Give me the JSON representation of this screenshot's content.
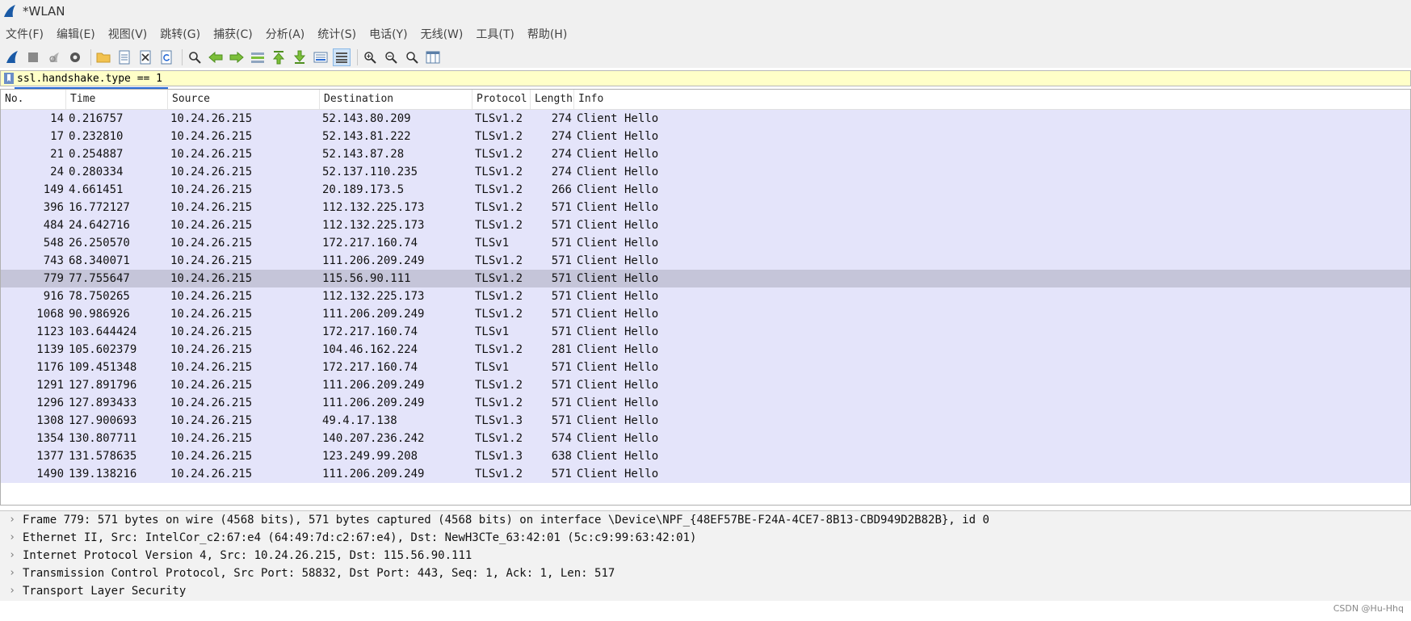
{
  "window": {
    "title": "*WLAN"
  },
  "menu": [
    "文件(F)",
    "编辑(E)",
    "视图(V)",
    "跳转(G)",
    "捕获(C)",
    "分析(A)",
    "统计(S)",
    "电话(Y)",
    "无线(W)",
    "工具(T)",
    "帮助(H)"
  ],
  "toolbar": {
    "icons": [
      "shark-fin-start-icon",
      "stop-capture-icon",
      "restart-capture-icon",
      "capture-options-icon",
      "open-folder-icon",
      "save-file-icon",
      "close-file-icon",
      "reload-icon",
      "find-packet-icon",
      "go-back-icon",
      "go-forward-icon",
      "go-to-packet-icon",
      "go-first-icon",
      "go-last-icon",
      "auto-scroll-icon",
      "colorize-icon",
      "zoom-in-icon",
      "zoom-out-icon",
      "zoom-reset-icon",
      "resize-columns-icon"
    ]
  },
  "filter": {
    "value": "ssl.handshake.type == 1"
  },
  "columns": [
    "No.",
    "Time",
    "Source",
    "Destination",
    "Protocol",
    "Length",
    "Info"
  ],
  "packets": [
    {
      "no": "14",
      "time": "0.216757",
      "src": "10.24.26.215",
      "dst": "52.143.80.209",
      "proto": "TLSv1.2",
      "len": "274",
      "info": "Client Hello"
    },
    {
      "no": "17",
      "time": "0.232810",
      "src": "10.24.26.215",
      "dst": "52.143.81.222",
      "proto": "TLSv1.2",
      "len": "274",
      "info": "Client Hello"
    },
    {
      "no": "21",
      "time": "0.254887",
      "src": "10.24.26.215",
      "dst": "52.143.87.28",
      "proto": "TLSv1.2",
      "len": "274",
      "info": "Client Hello"
    },
    {
      "no": "24",
      "time": "0.280334",
      "src": "10.24.26.215",
      "dst": "52.137.110.235",
      "proto": "TLSv1.2",
      "len": "274",
      "info": "Client Hello"
    },
    {
      "no": "149",
      "time": "4.661451",
      "src": "10.24.26.215",
      "dst": "20.189.173.5",
      "proto": "TLSv1.2",
      "len": "266",
      "info": "Client Hello"
    },
    {
      "no": "396",
      "time": "16.772127",
      "src": "10.24.26.215",
      "dst": "112.132.225.173",
      "proto": "TLSv1.2",
      "len": "571",
      "info": "Client Hello"
    },
    {
      "no": "484",
      "time": "24.642716",
      "src": "10.24.26.215",
      "dst": "112.132.225.173",
      "proto": "TLSv1.2",
      "len": "571",
      "info": "Client Hello"
    },
    {
      "no": "548",
      "time": "26.250570",
      "src": "10.24.26.215",
      "dst": "172.217.160.74",
      "proto": "TLSv1",
      "len": "571",
      "info": "Client Hello"
    },
    {
      "no": "743",
      "time": "68.340071",
      "src": "10.24.26.215",
      "dst": "111.206.209.249",
      "proto": "TLSv1.2",
      "len": "571",
      "info": "Client Hello"
    },
    {
      "no": "779",
      "time": "77.755647",
      "src": "10.24.26.215",
      "dst": "115.56.90.111",
      "proto": "TLSv1.2",
      "len": "571",
      "info": "Client Hello",
      "selected": true
    },
    {
      "no": "916",
      "time": "78.750265",
      "src": "10.24.26.215",
      "dst": "112.132.225.173",
      "proto": "TLSv1.2",
      "len": "571",
      "info": "Client Hello"
    },
    {
      "no": "1068",
      "time": "90.986926",
      "src": "10.24.26.215",
      "dst": "111.206.209.249",
      "proto": "TLSv1.2",
      "len": "571",
      "info": "Client Hello"
    },
    {
      "no": "1123",
      "time": "103.644424",
      "src": "10.24.26.215",
      "dst": "172.217.160.74",
      "proto": "TLSv1",
      "len": "571",
      "info": "Client Hello"
    },
    {
      "no": "1139",
      "time": "105.602379",
      "src": "10.24.26.215",
      "dst": "104.46.162.224",
      "proto": "TLSv1.2",
      "len": "281",
      "info": "Client Hello"
    },
    {
      "no": "1176",
      "time": "109.451348",
      "src": "10.24.26.215",
      "dst": "172.217.160.74",
      "proto": "TLSv1",
      "len": "571",
      "info": "Client Hello"
    },
    {
      "no": "1291",
      "time": "127.891796",
      "src": "10.24.26.215",
      "dst": "111.206.209.249",
      "proto": "TLSv1.2",
      "len": "571",
      "info": "Client Hello"
    },
    {
      "no": "1296",
      "time": "127.893433",
      "src": "10.24.26.215",
      "dst": "111.206.209.249",
      "proto": "TLSv1.2",
      "len": "571",
      "info": "Client Hello"
    },
    {
      "no": "1308",
      "time": "127.900693",
      "src": "10.24.26.215",
      "dst": "49.4.17.138",
      "proto": "TLSv1.3",
      "len": "571",
      "info": "Client Hello"
    },
    {
      "no": "1354",
      "time": "130.807711",
      "src": "10.24.26.215",
      "dst": "140.207.236.242",
      "proto": "TLSv1.2",
      "len": "574",
      "info": "Client Hello"
    },
    {
      "no": "1377",
      "time": "131.578635",
      "src": "10.24.26.215",
      "dst": "123.249.99.208",
      "proto": "TLSv1.3",
      "len": "638",
      "info": "Client Hello"
    },
    {
      "no": "1490",
      "time": "139.138216",
      "src": "10.24.26.215",
      "dst": "111.206.209.249",
      "proto": "TLSv1.2",
      "len": "571",
      "info": "Client Hello"
    }
  ],
  "details": [
    "Frame 779: 571 bytes on wire (4568 bits), 571 bytes captured (4568 bits) on interface \\Device\\NPF_{48EF57BE-F24A-4CE7-8B13-CBD949D2B82B}, id 0",
    "Ethernet II, Src: IntelCor_c2:67:e4 (64:49:7d:c2:67:e4), Dst: NewH3CTe_63:42:01 (5c:c9:99:63:42:01)",
    "Internet Protocol Version 4, Src: 10.24.26.215, Dst: 115.56.90.111",
    "Transmission Control Protocol, Src Port: 58832, Dst Port: 443, Seq: 1, Ack: 1, Len: 517",
    "Transport Layer Security"
  ],
  "watermark": "CSDN @Hu-Hhq",
  "colors": {
    "row_bg": "#e4e4fa",
    "selected_row_bg": "#c5c5d9",
    "filter_bg": "#ffffc8",
    "accent": "#2a6cd6"
  }
}
